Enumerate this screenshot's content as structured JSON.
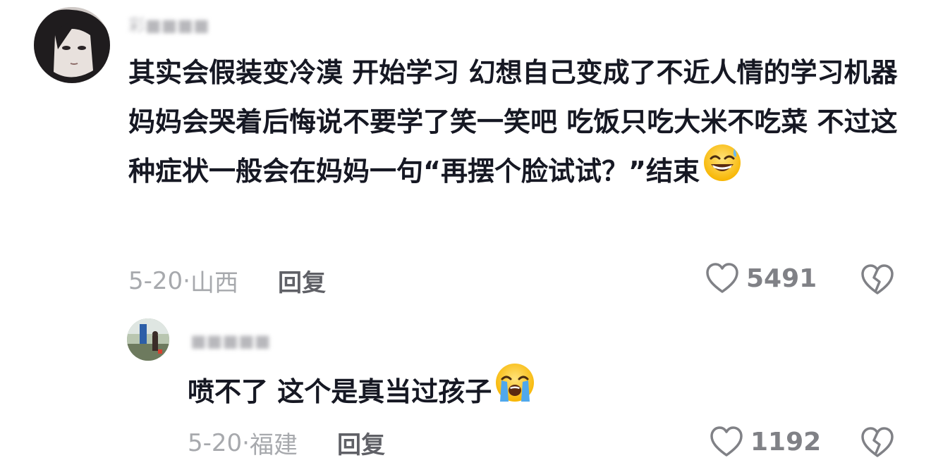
{
  "comment": {
    "username": "彩■■■■",
    "text": "其实会假装变冷漠 开始学习 幻想自己变成了不近人情的学习机器 妈妈会哭着后悔说不要学了笑一笑吧 吃饭只吃大米不吃菜 不过这种症状一般会在妈妈一句“再摆个脸试试？”结束",
    "emoji": "grinning-sweat-emoji",
    "date": "5-20",
    "separator": "·",
    "location": "山西",
    "reply_label": "回复",
    "likes": "5491"
  },
  "reply": {
    "username": "■■■■■",
    "text": "喷不了 这个是真当过孩子",
    "emoji": "loudly-crying-emoji",
    "date": "5-20",
    "separator": "·",
    "location": "福建",
    "reply_label": "回复",
    "likes": "1192"
  },
  "colors": {
    "text_primary": "#161823",
    "text_meta": "#a7a9ad",
    "text_reply_button": "#5f6066",
    "icon": "#808186"
  }
}
